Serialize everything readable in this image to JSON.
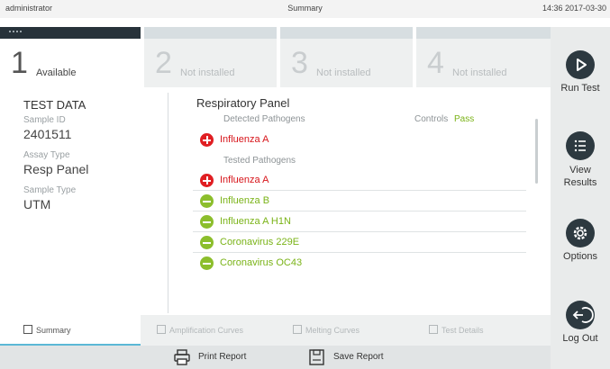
{
  "topbar": {
    "user": "administrator",
    "title": "Summary",
    "clock": "14:36 2017-03-30"
  },
  "modules": [
    {
      "num": "1",
      "label": "Available",
      "active": true
    },
    {
      "num": "2",
      "label": "Not installed",
      "active": false
    },
    {
      "num": "3",
      "label": "Not installed",
      "active": false
    },
    {
      "num": "4",
      "label": "Not installed",
      "active": false
    }
  ],
  "sidebar": {
    "run_test": "Run Test",
    "view_results": "View\nResults",
    "options": "Options",
    "log_out": "Log Out"
  },
  "test_data": {
    "header": "TEST DATA",
    "sample_id_label": "Sample ID",
    "sample_id": "2401511",
    "assay_type_label": "Assay Type",
    "assay_type": "Resp Panel",
    "sample_type_label": "Sample Type",
    "sample_type": "UTM"
  },
  "panel": {
    "title": "Respiratory Panel",
    "detected_label": "Detected Pathogens",
    "controls_label": "Controls",
    "controls_value": "Pass",
    "detected": [
      {
        "name": "Influenza A",
        "status": "positive"
      }
    ],
    "tested_label": "Tested Pathogens",
    "tested": [
      {
        "name": "Influenza A",
        "status": "positive"
      },
      {
        "name": "Influenza B",
        "status": "negative"
      },
      {
        "name": "Influenza A H1N",
        "status": "negative"
      },
      {
        "name": "Coronavirus 229E",
        "status": "negative"
      },
      {
        "name": "Coronavirus OC43",
        "status": "negative"
      }
    ]
  },
  "bottom_tabs": [
    {
      "label": "Summary",
      "active": true
    },
    {
      "label": "Amplification Curves",
      "active": false
    },
    {
      "label": "Melting Curves",
      "active": false
    },
    {
      "label": "Test Details",
      "active": false
    }
  ],
  "actions": {
    "print_report": "Print Report",
    "save_report": "Save Report"
  },
  "colors": {
    "positive": "#e01e22",
    "negative": "#8cbe2c",
    "pass": "#7ab317",
    "accent": "#5bb8d6",
    "dark": "#2d3940"
  },
  "icons": [
    "play-icon",
    "list-icon",
    "gear-icon",
    "logout-icon",
    "printer-icon",
    "save-icon",
    "plus-icon",
    "minus-icon"
  ]
}
